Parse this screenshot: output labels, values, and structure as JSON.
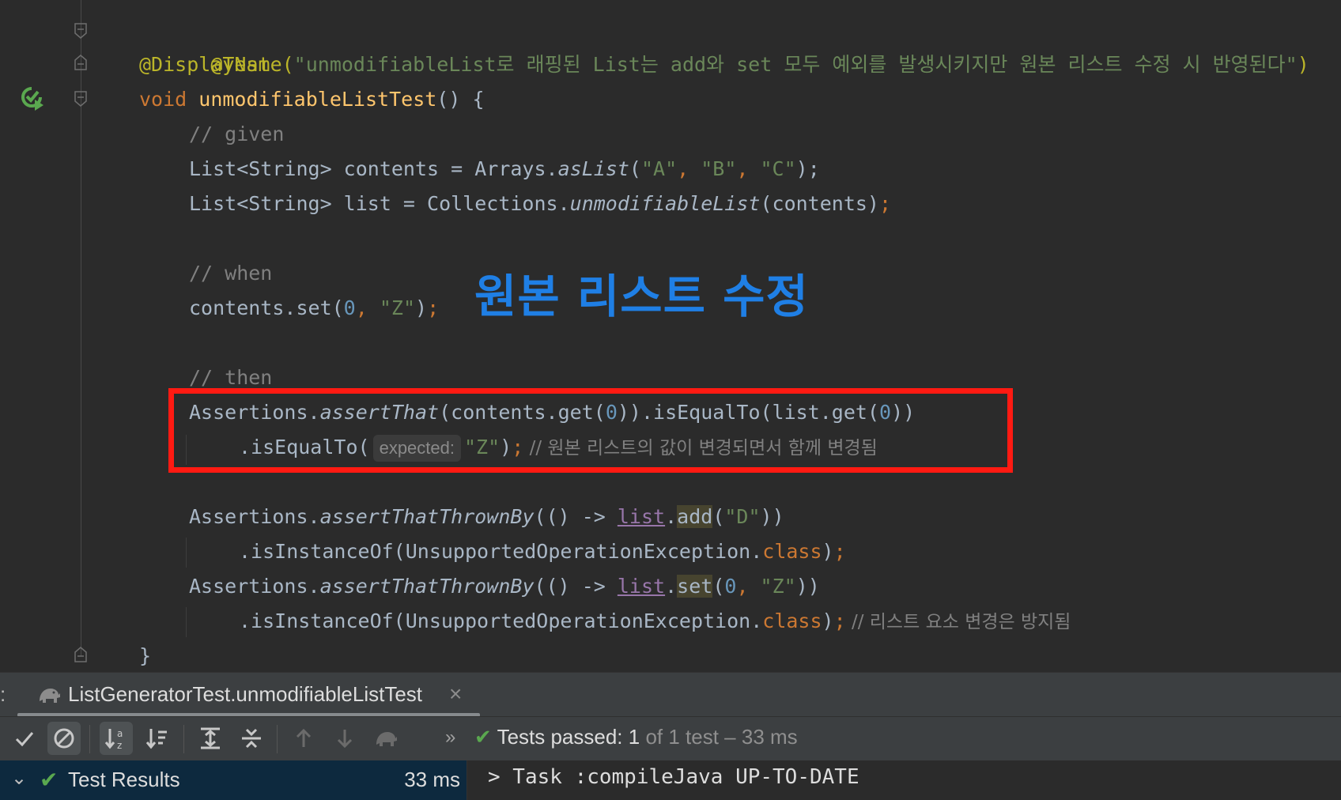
{
  "editor": {
    "lines": {
      "annotation_test": "@Test",
      "display_name_prefix": "@DisplayName(",
      "display_name_text": "\"unmodifiableList로 래핑된 List는 add와 set 모두 예외를 발생시키지만 원본 리스트 수정 시 반영된다\"",
      "display_name_suffix": ")",
      "void_kw": "void ",
      "method_name": "unmodifiableListTest",
      "method_suffix": "() {",
      "comment_given": "// given",
      "l1_a": "List<String> contents = Arrays.",
      "l1_fn": "asList",
      "l1_b": "(",
      "l1_s1": "\"A\"",
      "l1_c1": ", ",
      "l1_s2": "\"B\"",
      "l1_c2": ", ",
      "l1_s3": "\"C\"",
      "l1_end": ");",
      "l2_a": "List<String> list = Collections.",
      "l2_fn": "unmodifiableList",
      "l2_b": "(contents)",
      "l2_end": ";",
      "comment_when": "// when",
      "l3_a": "contents.set(",
      "l3_num": "0",
      "l3_c": ", ",
      "l3_s": "\"Z\"",
      "l3_b": ")",
      "l3_end": ";",
      "comment_then": "// then",
      "l4_a": "Assertions.",
      "l4_fn": "assertThat",
      "l4_b": "(contents.get(",
      "l4_n1": "0",
      "l4_c": ")).isEqualTo(list.get(",
      "l4_n2": "0",
      "l4_d": "))",
      "l5_a": ".isEqualTo(",
      "l5_hint": "expected:",
      "l5_s": "\"Z\"",
      "l5_b": ")",
      "l5_end": ";",
      "l5_comment": " // 원본 리스트의 값이 변경되면서 함께 변경됨",
      "l6_a": "Assertions.",
      "l6_fn": "assertThatThrownBy",
      "l6_b": "(() -> ",
      "l6_var": "list",
      "l6_dot": ".",
      "l6_m": "add",
      "l6_c": "(",
      "l6_s": "\"D\"",
      "l6_d": "))",
      "l7_a": ".isInstanceOf(UnsupportedOperationException.",
      "l7_kw": "class",
      "l7_b": ")",
      "l7_end": ";",
      "l8_a": "Assertions.",
      "l8_fn": "assertThatThrownBy",
      "l8_b": "(() -> ",
      "l8_var": "list",
      "l8_dot": ".",
      "l8_m": "set",
      "l8_c": "(",
      "l8_n": "0",
      "l8_comma": ", ",
      "l8_s": "\"Z\"",
      "l8_d": "))",
      "l9_a": ".isInstanceOf(UnsupportedOperationException.",
      "l9_kw": "class",
      "l9_b": ")",
      "l9_end": ";",
      "l9_comment": " // 리스트 요소 변경은 방지됨",
      "close_brace": "}"
    },
    "overlay_title": "원본 리스트 수정",
    "highlight_color": "#ff1a12",
    "overlay_color": "#1f7fe5"
  },
  "run_tab": {
    "prefix": ":",
    "title": "ListGeneratorTest.unmodifiableListTest",
    "close": "×"
  },
  "toolbar": {
    "icons": [
      "check-icon",
      "cancel-icon",
      "sort-alpha-icon",
      "sort-duration-icon",
      "expand-all-icon",
      "collapse-all-icon",
      "arrow-up-icon",
      "arrow-down-icon",
      "rerun-icon"
    ],
    "more": "»",
    "status_prefix": "Tests passed: ",
    "status_count": "1",
    "status_suffix": " of 1 test – 33 ms"
  },
  "results": {
    "label": "Test Results",
    "time": "33 ms"
  },
  "console": {
    "text": "> Task :compileJava UP-TO-DATE"
  },
  "colors": {
    "passed_green": "#5aa84f",
    "results_bg": "#0d293e"
  }
}
